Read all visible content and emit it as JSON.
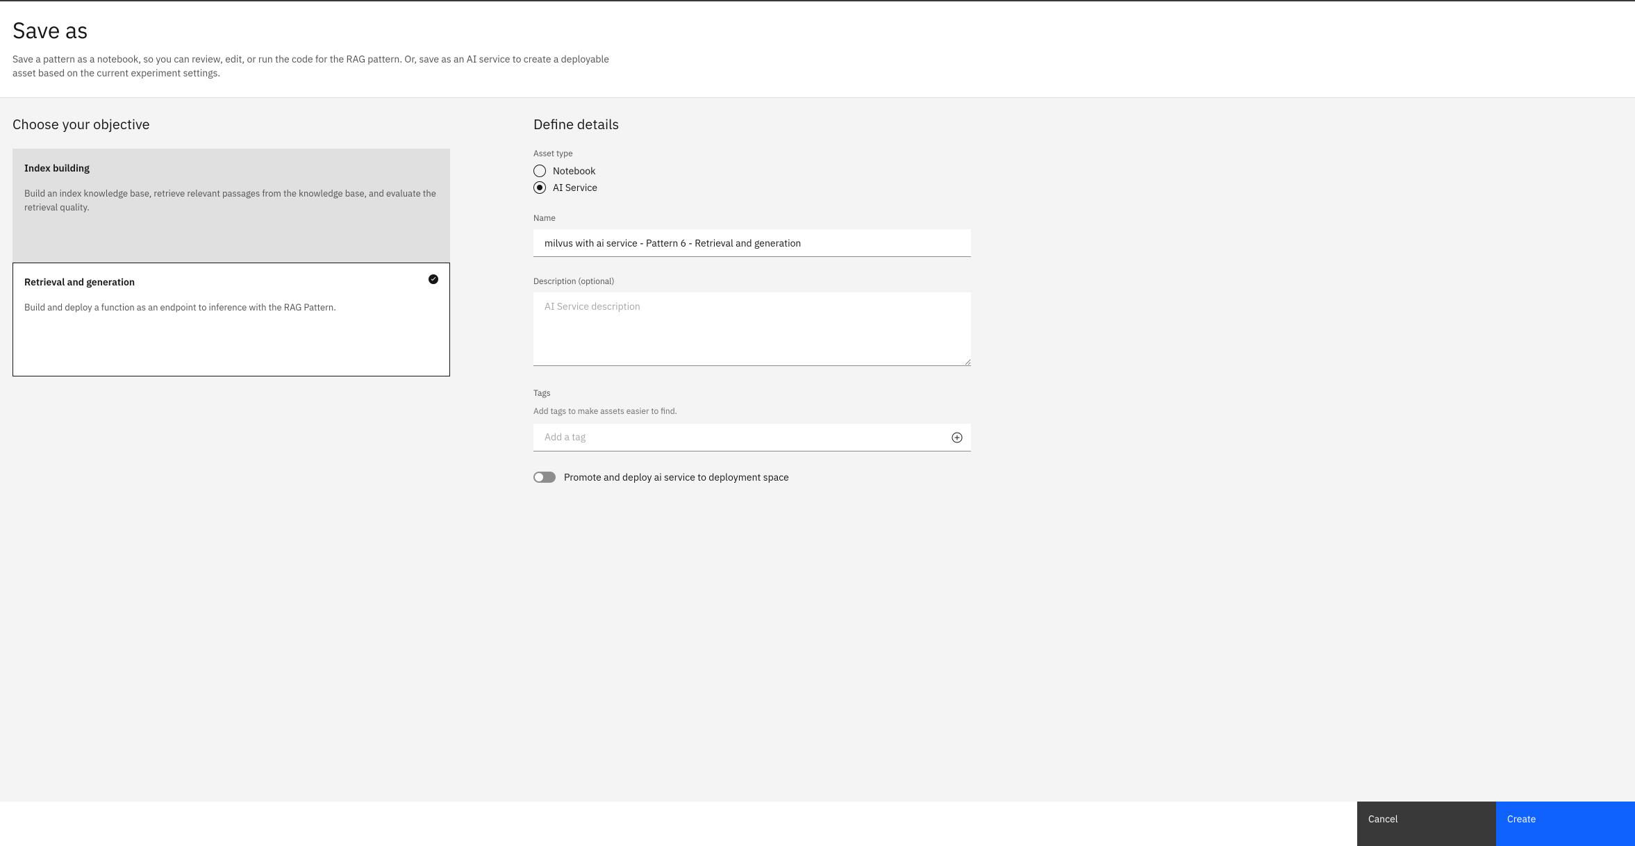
{
  "header": {
    "title": "Save as",
    "subtitle": "Save a pattern as a notebook, so you can review, edit, or run the code for the RAG pattern. Or, save as an AI service to create a deployable asset based on the current experiment settings."
  },
  "objective": {
    "heading": "Choose your objective",
    "options": [
      {
        "title": "Index building",
        "desc": "Build an index knowledge base, retrieve relevant passages from the knowledge base, and evaluate the retrieval quality.",
        "selected": false
      },
      {
        "title": "Retrieval and generation",
        "desc": "Build and deploy a function as an endpoint to inference with the RAG Pattern.",
        "selected": true
      }
    ]
  },
  "details": {
    "heading": "Define details",
    "asset_type": {
      "label": "Asset type",
      "options": {
        "notebook": "Notebook",
        "ai_service": "AI Service"
      },
      "selected": "ai_service"
    },
    "name": {
      "label": "Name",
      "value": "milvus with ai service - Pattern 6 - Retrieval and generation"
    },
    "description": {
      "label": "Description (optional)",
      "placeholder": "AI Service description",
      "value": ""
    },
    "tags": {
      "label": "Tags",
      "help": "Add tags to make assets easier to find.",
      "placeholder": "Add a tag",
      "value": ""
    },
    "promote": {
      "label": "Promote and deploy ai service to deployment space",
      "value": false
    }
  },
  "footer": {
    "cancel": "Cancel",
    "create": "Create"
  }
}
